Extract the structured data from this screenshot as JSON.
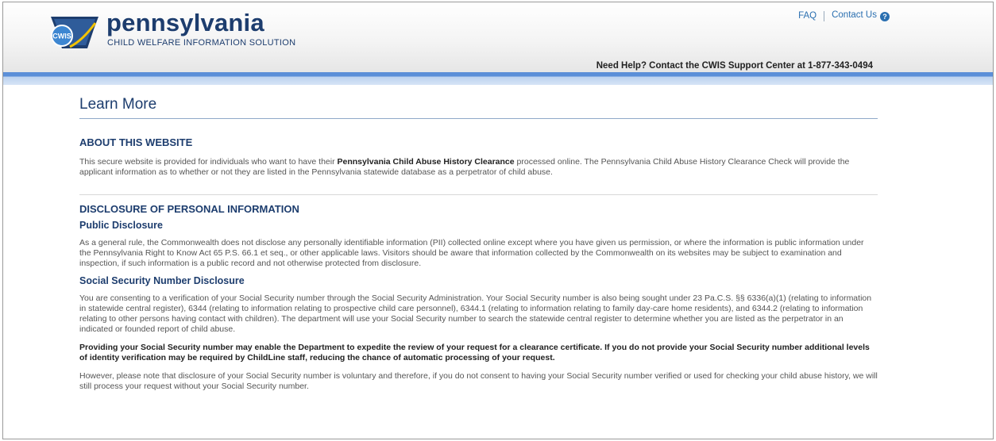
{
  "header": {
    "brand_name": "pennsylvania",
    "brand_tagline": "CHILD WELFARE INFORMATION SOLUTION",
    "logo_text": "CWIS",
    "faq_label": "FAQ",
    "contact_label": "Contact Us",
    "support_text": "Need Help? Contact the CWIS Support Center at 1-877-343-0494"
  },
  "colors": {
    "brand": "#1d3d6e",
    "link": "#2a6fb0",
    "bar": "#5b8fd8"
  },
  "page": {
    "title": "Learn More",
    "about": {
      "heading": "ABOUT THIS WEBSITE",
      "text_1": "This secure website is provided for individuals who want to have their",
      "text_bold": "Pennsylvania Child Abuse History Clearance",
      "text_2": "processed online. The Pennsylvania Child Abuse History Clearance Check will provide the applicant information as to whether or not they are listed in the Pennsylvania statewide database as a perpetrator of child abuse."
    },
    "disclosure": {
      "heading": "DISCLOSURE OF PERSONAL INFORMATION",
      "public_heading": "Public Disclosure",
      "public_text": "As a general rule, the Commonwealth does not disclose any personally identifiable information (PII) collected online except where you have given us permission, or where the information is public information under the Pennsylvania Right to Know Act 65 P.S. 66.1 et seq., or other applicable laws. Visitors should be aware that information collected by the Commonwealth on its websites may be subject to examination and inspection, if such information is a public record and not otherwise protected from disclosure.",
      "ssn_heading": "Social Security Number Disclosure",
      "ssn_text": "You are consenting to a verification of your Social Security number through the Social Security Administration. Your Social Security number is also being sought under 23 Pa.C.S. §§ 6336(a)(1) (relating to information in statewide central register), 6344 (relating to information relating to prospective child care personnel), 6344.1 (relating to information relating to family day-care home residents), and 6344.2 (relating to information relating to other persons having contact with children). The department will use your Social Security number to search the statewide central register to determine whether you are listed as the perpetrator in an indicated or founded report of child abuse.",
      "ssn_bold": "Providing your Social Security number may enable the Department to expedite the review of your request for a clearance certificate.  If you do not provide your Social Security number additional levels of identity verification may be required by ChildLine staff, reducing the chance of automatic processing of your request.",
      "ssn_voluntary": "However, please note that disclosure of your Social Security number is voluntary and therefore, if you do not consent to having your Social Security number verified or used for checking your child abuse history, we will still process your request without your Social Security number."
    }
  }
}
